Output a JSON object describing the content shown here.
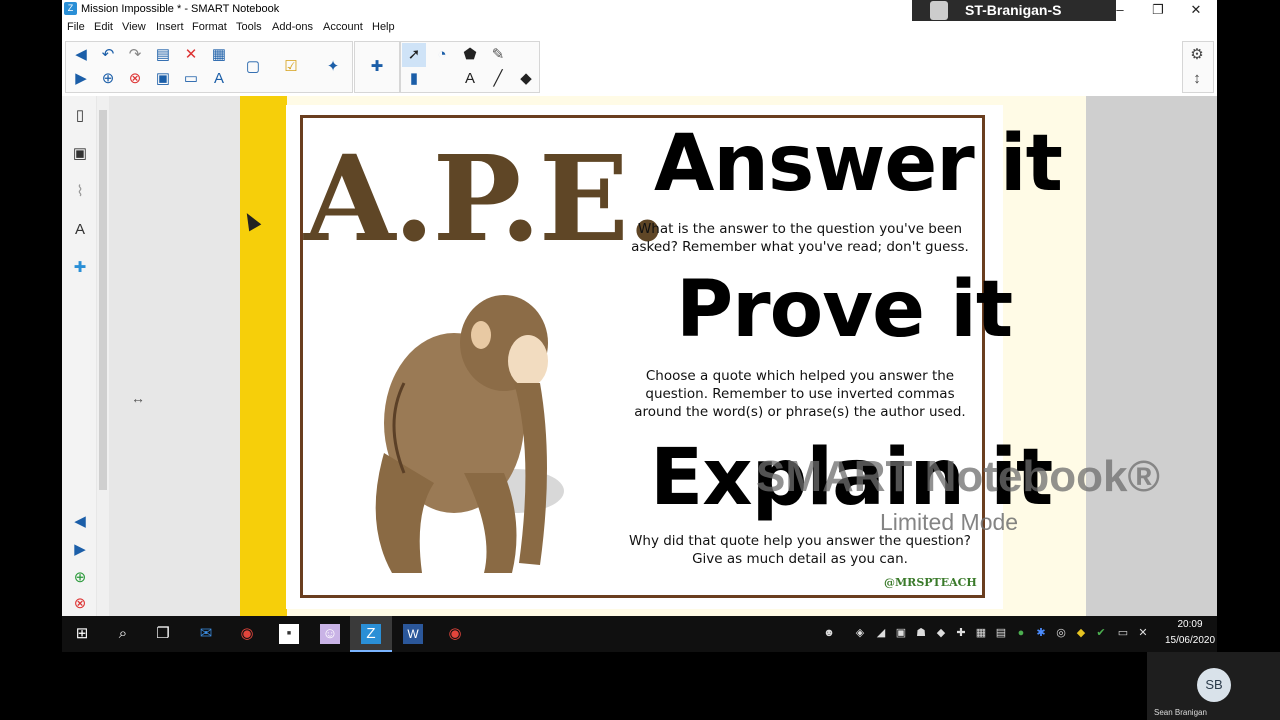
{
  "window": {
    "title": "Mission Impossible * - SMART Notebook",
    "app_icon": "Z",
    "user": "ST-Branigan-S"
  },
  "menu": [
    "File",
    "Edit",
    "View",
    "Insert",
    "Format",
    "Tools",
    "Add-ons",
    "Account",
    "Help"
  ],
  "poster": {
    "acronym": "A.P.E.",
    "sections": [
      {
        "heading": "Answer it",
        "text_lines": [
          "What is the answer to the question you've been",
          "asked? Remember what you've read; don't guess."
        ]
      },
      {
        "heading": "Prove it",
        "text_lines": [
          "Choose a quote which helped you answer the",
          "question.  Remember to use inverted commas",
          "around the word(s) or phrase(s) the author used."
        ]
      },
      {
        "heading": "Explain it",
        "text_lines": [
          "Why did that quote help you answer the question?",
          "Give as much detail as you can."
        ]
      }
    ],
    "handle": "@MRSPTEACH"
  },
  "watermark": {
    "line1": "SMART Notebook®",
    "line2": "Limited Mode"
  },
  "clock": {
    "time": "20:09",
    "date": "15/06/2020"
  },
  "participant": {
    "initials": "SB",
    "name": "Sean Branigan"
  },
  "colors": {
    "accent_yellow": "#f6cf0a",
    "ape_brown": "#5f4626",
    "frame_brown": "#6a3e1f"
  }
}
